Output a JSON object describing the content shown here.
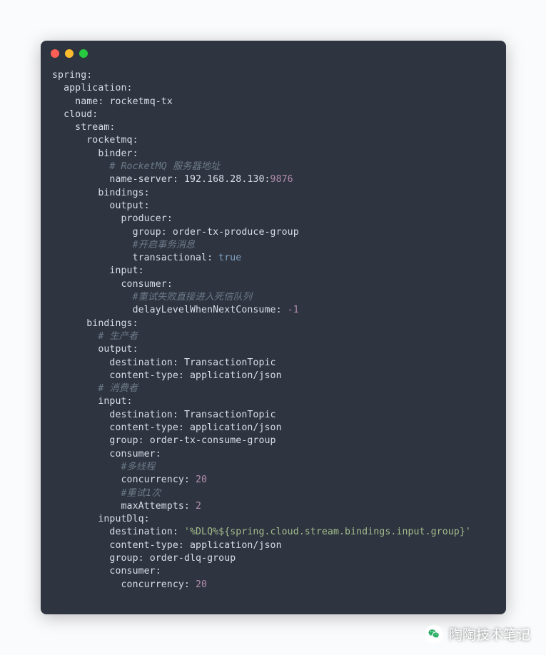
{
  "code": {
    "spring": "spring",
    "application": "application",
    "name": "name",
    "name_val": "rocketmq-tx",
    "cloud": "cloud",
    "stream": "stream",
    "rocketmq": "rocketmq",
    "binder": "binder",
    "cmt_addr": "# RocketMQ 服务器地址",
    "name_server": "name-server",
    "name_server_val": "192.168.28.130:",
    "name_server_port": "9876",
    "bindings": "bindings",
    "output": "output",
    "producer": "producer",
    "group": "group",
    "tx_produce_group": "order-tx-produce-group",
    "cmt_txmsg": "#开启事务消息",
    "transactional": "transactional",
    "true": "true",
    "input": "input",
    "consumer": "consumer",
    "cmt_dlq": "#重试失败直接进入死信队列",
    "delayLevel": "delayLevelWhenNextConsume",
    "neg1": "-1",
    "cmt_producer": "# 生产者",
    "destination": "destination",
    "topic": "TransactionTopic",
    "content_type": "content-type",
    "json": "application/json",
    "cmt_consumer": "# 消费者",
    "tx_consume_group": "order-tx-consume-group",
    "cmt_mt": "#多线程",
    "concurrency": "concurrency",
    "c20": "20",
    "cmt_retry": "#重试1次",
    "maxAttempts": "maxAttempts",
    "c2": "2",
    "inputDlq": "inputDlq",
    "dlq_dest": "'%DLQ%${spring.cloud.stream.bindings.input.group}'",
    "dlq_group": "order-dlq-group"
  },
  "watermark": "陶陶技术笔记"
}
